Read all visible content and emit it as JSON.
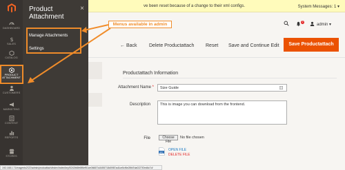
{
  "left_nav": {
    "items": [
      {
        "label": "DASHBOARD"
      },
      {
        "label": "SALES"
      },
      {
        "label": "CATALOG"
      },
      {
        "label": "PRODUCT ATTACHMENT"
      },
      {
        "label": "CUSTOMERS"
      },
      {
        "label": "MARKETING"
      },
      {
        "label": "CONTENT"
      },
      {
        "label": "REPORTS"
      },
      {
        "label": "STORES"
      }
    ]
  },
  "flyout": {
    "title": "Product Attachment",
    "close": "×",
    "links": [
      "Manage Attachments",
      "Settings"
    ]
  },
  "notice": {
    "text": "ve been reset because of a change to their xml configs.",
    "system_messages": "System Messages: 1 ▾"
  },
  "header": {
    "notifications_count": "2",
    "user": "admin ▾"
  },
  "actions": {
    "back": "← Back",
    "delete": "Delete Productattach",
    "reset": "Reset",
    "save_continue": "Save and Continue Edit",
    "save": "Save Productattach"
  },
  "form": {
    "section_title": "Productattach Information",
    "attachment_name_label": "Attachment Name",
    "required_mark": "*",
    "attachment_name_value": "Size Guide",
    "description_label": "Description",
    "description_value": "This is image you can download from the frontend.",
    "file_label": "File",
    "choose_file": "Choose File",
    "no_file": "No file chosen",
    "file_type": "JPG",
    "open_file": "OPEN FILE",
    "delete_file": "DELETE FILE"
  },
  "annotation": {
    "callout": "Menus available in admin"
  },
  "statusbar": {
    "url": "192.168.1.71/magento2/22/admin/prodcattach/index/index/key/5242fd6fe8f6ef51ce066f27a3455718d0987ad1ce5cf6e28fd7da0227f2ed6c7d/"
  },
  "colors": {
    "accent": "#eb5202",
    "annotation": "#f08c2a",
    "sidebar": "#373330",
    "flyout": "#3e3a36"
  }
}
